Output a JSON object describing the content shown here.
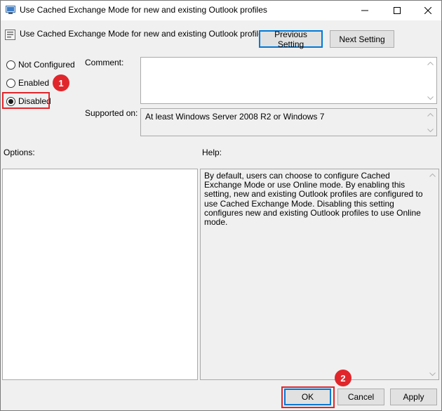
{
  "window": {
    "title": "Use Cached Exchange Mode for new and existing Outlook profiles"
  },
  "header": {
    "title": "Use Cached Exchange Mode for new and existing Outlook profiles",
    "previous_label": "Previous Setting",
    "next_label": "Next Setting"
  },
  "state": {
    "options": [
      {
        "label": "Not Configured",
        "checked": false
      },
      {
        "label": "Enabled",
        "checked": false
      },
      {
        "label": "Disabled",
        "checked": true
      }
    ]
  },
  "comment": {
    "label": "Comment:",
    "value": ""
  },
  "supported": {
    "label": "Supported on:",
    "value": "At least Windows Server 2008 R2 or Windows 7"
  },
  "options_panel": {
    "label": "Options:"
  },
  "help_panel": {
    "label": "Help:",
    "text": "By default, users can choose to configure Cached Exchange Mode or use Online mode. By enabling this setting, new and existing Outlook profiles are configured to use Cached Exchange Mode. Disabling this setting configures new and existing Outlook profiles to use Online mode."
  },
  "footer": {
    "ok_label": "OK",
    "cancel_label": "Cancel",
    "apply_label": "Apply"
  },
  "annotations": {
    "step1": "1",
    "step2": "2",
    "color": "#e0262b"
  },
  "icons": [
    "policy-icon",
    "minimize-icon",
    "maximize-icon",
    "close-icon",
    "scroll-up-icon",
    "scroll-down-icon"
  ]
}
